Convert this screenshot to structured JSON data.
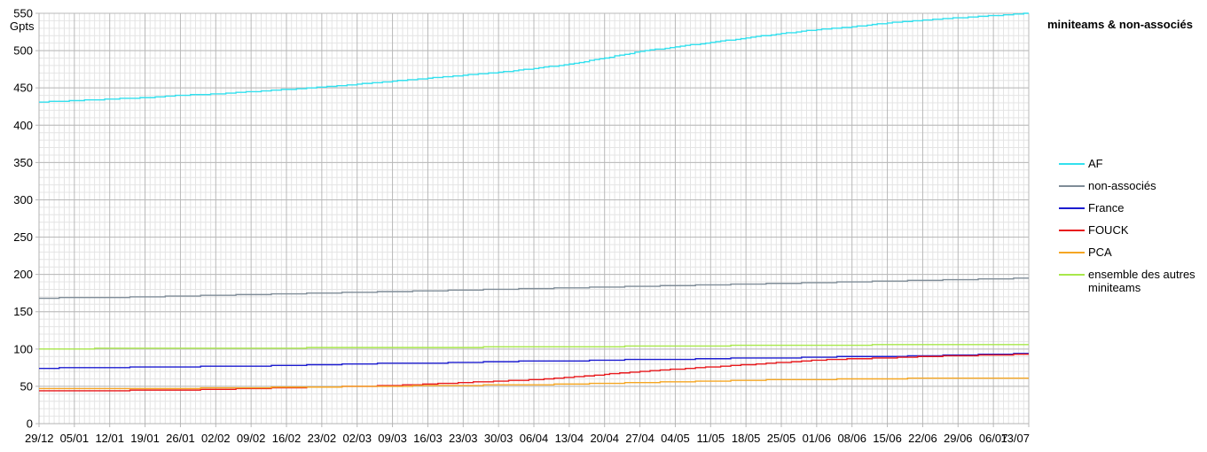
{
  "chart_data": {
    "type": "line",
    "title": "miniteams & non-associés",
    "ylabel": "Gpts",
    "xlabel": "",
    "ylim": [
      0,
      550
    ],
    "y_ticks": [
      0,
      50,
      100,
      150,
      200,
      250,
      300,
      350,
      400,
      450,
      500,
      550
    ],
    "grid": true,
    "legend_position": "right",
    "x": [
      "29/12",
      "05/01",
      "12/01",
      "19/01",
      "26/01",
      "02/02",
      "09/02",
      "16/02",
      "23/02",
      "02/03",
      "09/03",
      "16/03",
      "23/03",
      "30/03",
      "06/04",
      "13/04",
      "20/04",
      "27/04",
      "04/05",
      "11/05",
      "18/05",
      "25/05",
      "01/06",
      "08/06",
      "15/06",
      "22/06",
      "29/06",
      "06/07",
      "13/07"
    ],
    "series": [
      {
        "name": "AF",
        "color": "#33e0ee",
        "values": [
          431,
          433,
          435,
          437,
          440,
          442,
          445,
          448,
          451,
          455,
          459,
          463,
          467,
          471,
          476,
          482,
          490,
          499,
          505,
          511,
          517,
          523,
          528,
          532,
          537,
          541,
          544,
          547,
          550
        ]
      },
      {
        "name": "non-associés",
        "color": "#7f8c97",
        "values": [
          168,
          169,
          169,
          170,
          171,
          172,
          173,
          174,
          175,
          176,
          177,
          178,
          179,
          180,
          181,
          182,
          183,
          184,
          185,
          186,
          187,
          188,
          189,
          190,
          191,
          192,
          193,
          194,
          195
        ]
      },
      {
        "name": "France",
        "color": "#1c1cd0",
        "values": [
          74,
          75,
          75,
          76,
          76,
          77,
          77,
          78,
          79,
          80,
          81,
          81,
          82,
          83,
          84,
          84,
          85,
          86,
          86,
          87,
          88,
          88,
          89,
          90,
          90,
          91,
          92,
          93,
          94
        ]
      },
      {
        "name": "FOUCK",
        "color": "#e8191c",
        "values": [
          44,
          44,
          44,
          45,
          45,
          46,
          47,
          48,
          49,
          50,
          51,
          53,
          55,
          57,
          59,
          62,
          66,
          70,
          73,
          76,
          79,
          82,
          85,
          87,
          88,
          90,
          91,
          92,
          93
        ]
      },
      {
        "name": "PCA",
        "color": "#f5a623",
        "values": [
          47,
          47,
          47,
          47,
          47,
          48,
          48,
          49,
          49,
          50,
          50,
          51,
          51,
          52,
          52,
          53,
          54,
          55,
          56,
          57,
          58,
          59,
          59,
          60,
          60,
          61,
          61,
          61,
          61
        ]
      },
      {
        "name": "ensemble des autres miniteams",
        "color": "#a8e84a",
        "values": [
          100,
          100,
          101,
          101,
          101,
          101,
          101,
          101,
          102,
          102,
          102,
          102,
          102,
          103,
          103,
          103,
          103,
          104,
          104,
          104,
          105,
          105,
          105,
          105,
          106,
          106,
          106,
          106,
          106
        ]
      }
    ]
  }
}
